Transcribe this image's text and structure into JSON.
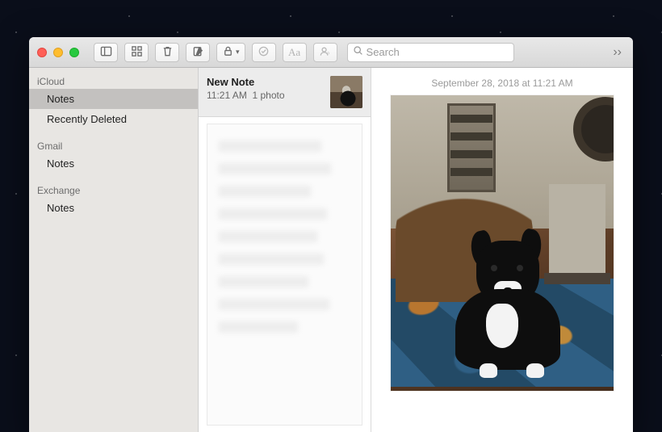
{
  "toolbar": {
    "search_placeholder": "Search",
    "icons": {
      "sidebar_toggle": "sidebar-toggle-icon",
      "grid_view": "grid-view-icon",
      "trash": "trash-icon",
      "compose": "compose-icon",
      "lock": "lock-icon",
      "checklist": "checklist-icon",
      "format": "Aa",
      "share": "share-icon",
      "overflow": "››"
    }
  },
  "sidebar": {
    "accounts": [
      {
        "name": "iCloud",
        "folders": [
          {
            "label": "Notes",
            "selected": true
          },
          {
            "label": "Recently Deleted",
            "selected": false
          }
        ]
      },
      {
        "name": "Gmail",
        "folders": [
          {
            "label": "Notes",
            "selected": false
          }
        ]
      },
      {
        "name": "Exchange",
        "folders": [
          {
            "label": "Notes",
            "selected": false
          }
        ]
      }
    ]
  },
  "notes_list": {
    "selected": {
      "title": "New Note",
      "time": "11:21 AM",
      "preview": "1 photo"
    }
  },
  "note": {
    "timestamp": "September 28, 2018 at 11:21 AM",
    "photo_alt": "black dog sitting on patterned rug in room"
  }
}
